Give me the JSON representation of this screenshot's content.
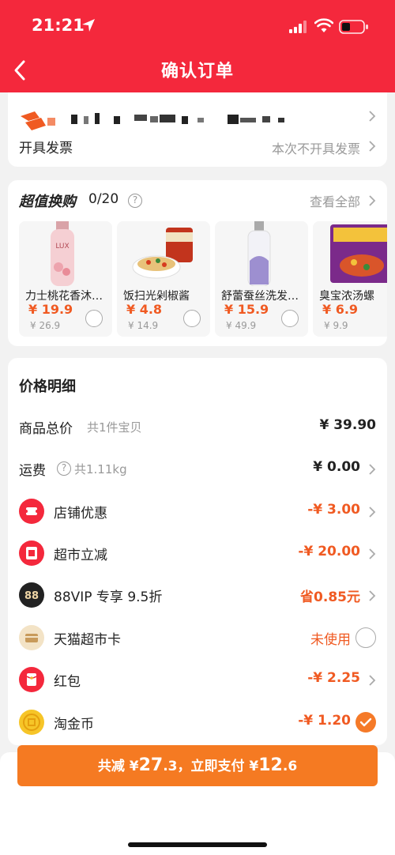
{
  "status_bar": {
    "time": "21:21"
  },
  "header": {
    "title": "确认订单"
  },
  "address": {
    "invoice_label": "开具发票",
    "invoice_value": "本次不开具发票"
  },
  "deals": {
    "title": "超值换购",
    "count": "0/20",
    "view_all": "查看全部",
    "items": [
      {
        "name": "力士桃花香沐…",
        "price": "¥ 19.9",
        "orig": "¥ 26.9"
      },
      {
        "name": "饭扫光剁椒酱",
        "price": "¥ 4.8",
        "orig": "¥ 14.9"
      },
      {
        "name": "舒蕾蚕丝洗发…",
        "price": "¥ 15.9",
        "orig": "¥ 49.9"
      },
      {
        "name": "臭宝浓汤螺",
        "price": "¥ 6.9",
        "orig": "¥ 9.9"
      }
    ]
  },
  "detail": {
    "title": "价格明细",
    "rows": [
      {
        "label": "商品总价",
        "sub": "共1件宝贝",
        "value": "¥ 39.90"
      },
      {
        "label": "运费",
        "sub": "共1.11kg",
        "value": "¥ 0.00"
      },
      {
        "label": "店铺优惠",
        "value": "-¥ 3.00"
      },
      {
        "label": "超市立减",
        "value": "-¥ 20.00"
      },
      {
        "label": "88VIP 专享 9.5折",
        "value": "省0.85元"
      },
      {
        "label": "天猫超市卡",
        "value": "未使用"
      },
      {
        "label": "红包",
        "value": "-¥ 2.25"
      },
      {
        "label": "淘金币",
        "value": "-¥ 1.20"
      }
    ]
  },
  "pay": {
    "prefix": "共减 ¥",
    "saved_int": "27",
    "saved_dec": ".3",
    "middle": "，立即支付 ¥",
    "pay_int": "12",
    "pay_dec": ".6"
  },
  "colors": {
    "brand": "#f4283c",
    "accent": "#f05a22",
    "button": "#f57a22"
  }
}
